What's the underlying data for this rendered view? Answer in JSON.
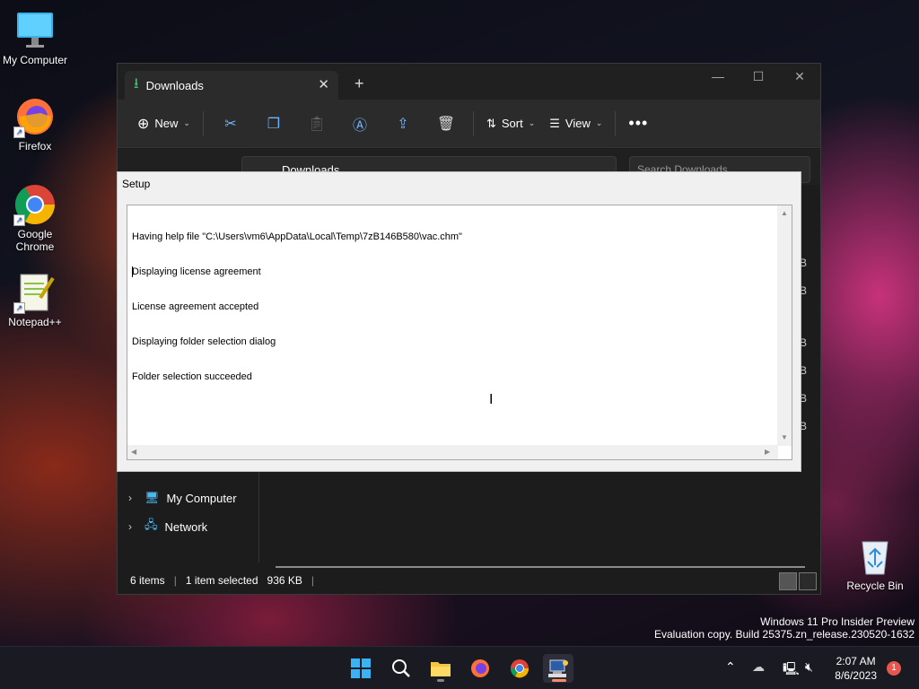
{
  "desktop": {
    "icons": [
      {
        "label": "My Computer",
        "icon": "monitor-icon"
      },
      {
        "label": "Firefox",
        "icon": "firefox-icon"
      },
      {
        "label": "Google Chrome",
        "icon": "chrome-icon"
      },
      {
        "label": "Notepad++",
        "icon": "notepadpp-icon"
      },
      {
        "label": "Recycle Bin",
        "icon": "recycle-bin-icon"
      }
    ],
    "watermark": {
      "line1": "Windows 11 Pro Insider Preview",
      "line2": "Evaluation copy. Build 25375.zn_release.230520-1632"
    }
  },
  "explorer": {
    "tab_title": "Downloads",
    "toolbar": {
      "new_label": "New",
      "sort_label": "Sort",
      "view_label": "View"
    },
    "address": "Downloads",
    "search_placeholder": "Search Downloads",
    "nav": [
      {
        "label": "My Computer",
        "icon": "monitor-icon"
      },
      {
        "label": "Network",
        "icon": "network-icon"
      }
    ],
    "size_suffix": "B",
    "status": {
      "items": "6 items",
      "selected": "1 item selected",
      "size": "936 KB"
    }
  },
  "setup": {
    "title": "Setup",
    "log": [
      "Having help file \"C:\\Users\\vm6\\AppData\\Local\\Temp\\7zB146B580\\vac.chm\"",
      "Displaying license agreement",
      "License agreement accepted",
      "Displaying folder selection dialog",
      "Folder selection succeeded"
    ]
  },
  "taskbar": {
    "apps": [
      "windows-start-icon",
      "search-icon",
      "file-explorer-icon",
      "firefox-icon",
      "chrome-icon",
      "setup-app-icon"
    ],
    "time": "2:07 AM",
    "date": "8/6/2023",
    "notification_count": "1"
  }
}
